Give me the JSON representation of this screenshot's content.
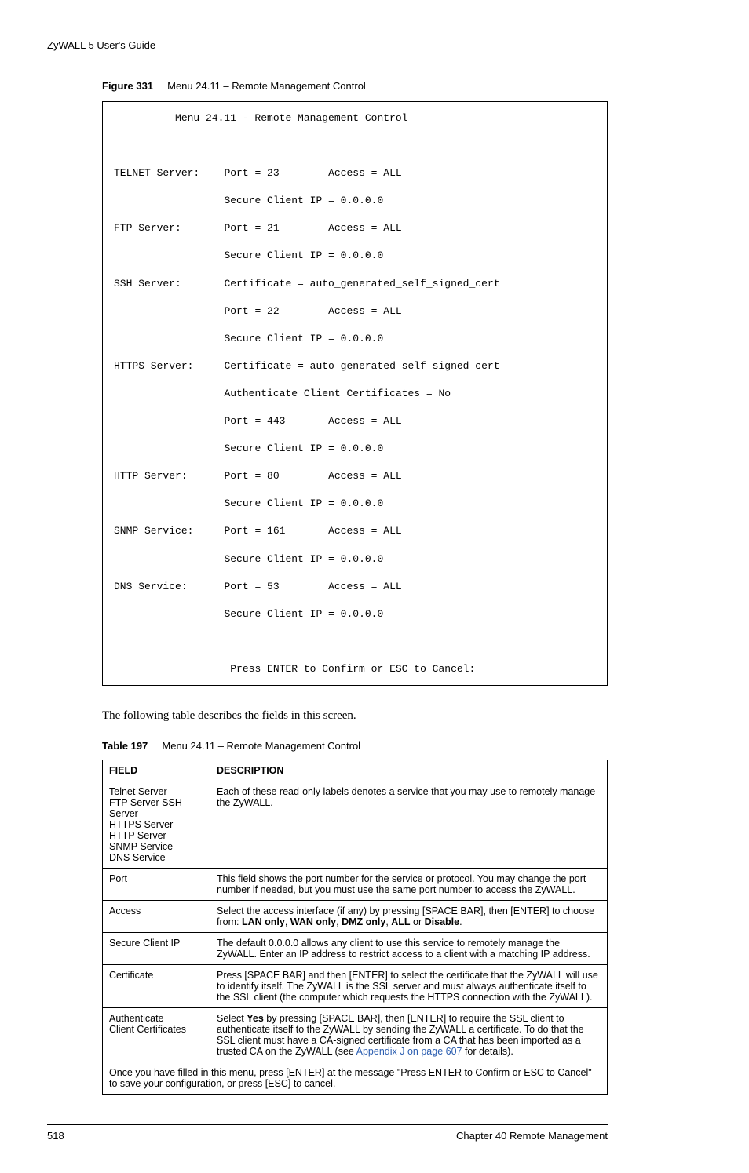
{
  "header": {
    "title": "ZyWALL 5 User's Guide"
  },
  "figure": {
    "label": "Figure 331",
    "title": "Menu 24.11 – Remote Management Control"
  },
  "terminal": {
    "title": "Menu 24.11 - Remote Management Control",
    "telnet_label": "TELNET Server:",
    "telnet_port": "Port = 23",
    "telnet_access": "Access = ALL",
    "telnet_ip": "Secure Client IP = 0.0.0.0",
    "ftp_label": "FTP Server:",
    "ftp_port": "Port = 21",
    "ftp_access": "Access = ALL",
    "ftp_ip": "Secure Client IP = 0.0.0.0",
    "ssh_label": "SSH Server:",
    "ssh_cert": "Certificate = auto_generated_self_signed_cert",
    "ssh_port": "Port = 22",
    "ssh_access": "Access = ALL",
    "ssh_ip": "Secure Client IP = 0.0.0.0",
    "https_label": "HTTPS Server:",
    "https_cert": "Certificate = auto_generated_self_signed_cert",
    "https_auth": "Authenticate Client Certificates = No",
    "https_port": "Port = 443",
    "https_access": "Access = ALL",
    "https_ip": "Secure Client IP = 0.0.0.0",
    "http_label": "HTTP Server:",
    "http_port": "Port = 80",
    "http_access": "Access = ALL",
    "http_ip": "Secure Client IP = 0.0.0.0",
    "snmp_label": "SNMP Service:",
    "snmp_port": "Port = 161",
    "snmp_access": "Access = ALL",
    "snmp_ip": "Secure Client IP = 0.0.0.0",
    "dns_label": "DNS Service:",
    "dns_port": "Port = 53",
    "dns_access": "Access = ALL",
    "dns_ip": "Secure Client IP = 0.0.0.0",
    "prompt": "Press ENTER to Confirm or ESC to Cancel:"
  },
  "intro": "The following table describes the fields in this screen.",
  "table_caption": {
    "label": "Table 197",
    "title": "Menu 24.11 – Remote Management Control"
  },
  "table": {
    "head_field": "FIELD",
    "head_desc": "DESCRIPTION",
    "rows": [
      {
        "field_lines": [
          "Telnet Server",
          "FTP Server SSH",
          "Server",
          "HTTPS Server",
          "HTTP Server",
          "SNMP Service",
          "DNS Service"
        ],
        "desc": "Each of these read-only labels denotes a service that you may use to remotely manage the ZyWALL."
      },
      {
        "field_lines": [
          "Port"
        ],
        "desc": "This field shows the port number for the service or protocol. You may change the port number if needed, but you must use the same port number to access the ZyWALL."
      },
      {
        "field_lines": [
          "Access"
        ],
        "desc_prefix": "Select the access interface (if any) by pressing [SPACE BAR], then [ENTER] to choose from: ",
        "opts": [
          "LAN only",
          "WAN only",
          "DMZ only",
          "ALL",
          "Disable"
        ],
        "desc_suffix": "."
      },
      {
        "field_lines": [
          "Secure Client IP"
        ],
        "desc": "The default 0.0.0.0 allows any client to use this service to remotely manage the ZyWALL. Enter an IP address to restrict access to a client with a matching IP address."
      },
      {
        "field_lines": [
          "Certificate"
        ],
        "desc": "Press [SPACE BAR] and then [ENTER] to select the certificate that the ZyWALL will use to identify itself. The ZyWALL is the SSL server and must always authenticate itself to the SSL client (the computer which requests the HTTPS connection with the ZyWALL)."
      },
      {
        "field_lines": [
          "Authenticate",
          "Client Certificates"
        ],
        "desc_prefix": "Select ",
        "bold1": "Yes",
        "desc_mid": " by pressing [SPACE BAR], then [ENTER] to require the SSL client to authenticate itself to the ZyWALL by sending the ZyWALL a certificate. To do that the SSL client must have a CA-signed certificate from a CA that has been imported as a trusted CA on the ZyWALL (see ",
        "link": "Appendix J on page 607",
        "desc_suffix": " for details)."
      }
    ],
    "footer_row": "Once you have filled in this menu, press [ENTER] at the message \"Press ENTER to Confirm or ESC to Cancel\" to save your configuration, or press [ESC] to cancel."
  },
  "footer": {
    "page": "518",
    "chapter": "Chapter 40 Remote Management"
  }
}
